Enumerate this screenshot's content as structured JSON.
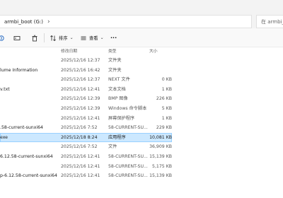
{
  "address": {
    "path": "armbi_boot (G:)",
    "search_placeholder": "在 armbi_b"
  },
  "toolbar": {
    "sort_label": "排序",
    "view_label": "查看",
    "more_label": "···"
  },
  "columns": {
    "date": "修改日期",
    "type": "类型",
    "size": "大小"
  },
  "files": [
    {
      "name": "",
      "date": "2025/12/16 12:37",
      "type": "文件夹",
      "size": ""
    },
    {
      "name": "lume Information",
      "date": "2025/12/16 16:42",
      "type": "文件夹",
      "size": ""
    },
    {
      "name": "",
      "date": "2025/12/16 12:37",
      "type": "NEXT 文件",
      "size": "0 KB"
    },
    {
      "name": "v.txt",
      "date": "2025/12/16 12:41",
      "type": "文本文档",
      "size": "1 KB"
    },
    {
      "name": "",
      "date": "2025/12/16 12:39",
      "type": "BMP 图像",
      "size": "226 KB"
    },
    {
      "name": "",
      "date": "2025/12/16 12:39",
      "type": "Windows 命令脚本",
      "size": "5 KB"
    },
    {
      "name": "",
      "date": "2025/12/16 12:41",
      "type": "屏幕保护程序",
      "size": "1 KB"
    },
    {
      "name": ".58-current-sunxi64",
      "date": "2025/12/16 7:52",
      "type": "58-CURRENT-SU...",
      "size": "229 KB"
    },
    {
      "name": "exe",
      "date": "2025/12/18 8:24",
      "type": "应用程序",
      "size": "10,081 KB",
      "selected": true
    },
    {
      "name": "",
      "date": "2025/12/16 7:52",
      "type": "文件",
      "size": "36,909 KB"
    },
    {
      "name": "6.12.58-current-sunxi64",
      "date": "2025/12/16 12:41",
      "type": "58-CURRENT-SU...",
      "size": "15,139 KB"
    },
    {
      "name": "",
      "date": "2025/12/16 12:41",
      "type": "58-CURRENT-SU...",
      "size": "5,175 KB"
    },
    {
      "name": "p-6.12.58-current-sunxi64",
      "date": "2025/12/16 12:41",
      "type": "58-CURRENT-SU...",
      "size": "15,139 KB"
    }
  ]
}
